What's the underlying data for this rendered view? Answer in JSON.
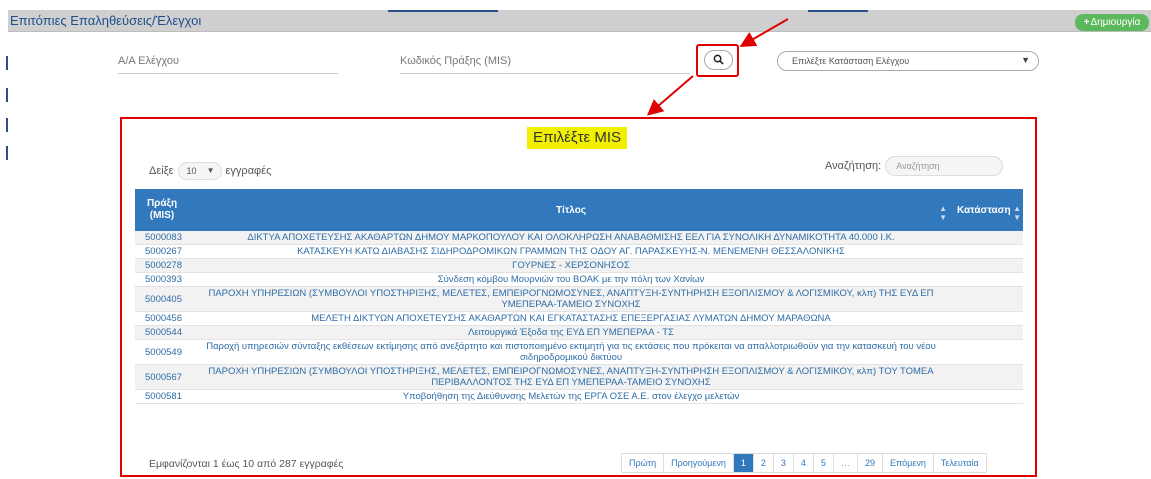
{
  "header": {
    "title": "Επιτόπιες Επαληθεύσεις/Έλεγχοι",
    "create_label": "Δημιουργία"
  },
  "filters": {
    "control_no_placeholder": "Α/Α Ελέγχου",
    "mis_code_placeholder": "Κωδικός Πράξης (MIS)",
    "status_placeholder": "Επιλέξτε Κατάσταση Ελέγχου"
  },
  "modal": {
    "title": "Επιλέξτε MIS",
    "show_label": "Δείξε",
    "page_length": "10",
    "records_label": "εγγραφές",
    "search_label": "Αναζήτηση:",
    "search_placeholder": "Αναζήτηση",
    "columns": {
      "mis_line1": "Πράξη",
      "mis_line2": "(MIS)",
      "title": "Τίτλος",
      "status": "Κατάσταση"
    },
    "rows": [
      {
        "mis": "5000083",
        "title": "ΔΙΚΤΥΑ ΑΠΟΧΕΤΕΥΣΗΣ ΑΚΑΘΑΡΤΩΝ ΔΗΜΟΥ ΜΑΡΚΟΠΟΥΛΟΥ ΚΑΙ ΟΛΟΚΛΗΡΩΣΗ ΑΝΑΒΑΘΜΙΣΗΣ ΕΕΛ ΓΙΑ ΣΥΝΟΛΙΚΗ ΔΥΝΑΜΙΚΟΤΗΤΑ 40.000 Ι.Κ.",
        "status": ""
      },
      {
        "mis": "5000267",
        "title": "ΚΑΤΑΣΚΕΥΗ ΚΑΤΩ ΔΙΑΒΑΣΗΣ ΣΙΔΗΡΟΔΡΟΜΙΚΩΝ ΓΡΑΜΜΩΝ ΤΗΣ ΟΔΟΥ ΑΓ. ΠΑΡΑΣΚΕΥΗΣ-Ν. ΜΕΝΕΜΕΝΗ ΘΕΣΣΑΛΟΝΙΚΗΣ",
        "status": ""
      },
      {
        "mis": "5000278",
        "title": "ΓΟΥΡΝΕΣ - ΧΕΡΣΟΝΗΣΟΣ",
        "status": ""
      },
      {
        "mis": "5000393",
        "title": "Σύνδεση κόμβου Μουρνιών του ΒΟΑΚ με την πόλη των Χανίων",
        "status": ""
      },
      {
        "mis": "5000405",
        "title": "ΠΑΡΟΧΗ ΥΠΗΡΕΣΙΩΝ (ΣΥΜΒΟΥΛΟΙ ΥΠΟΣΤΗΡΙΞΗΣ, ΜΕΛΕΤΕΣ, ΕΜΠΕΙΡΟΓΝΩΜΟΣΥΝΕΣ, ΑΝΑΠΤΥΞΗ-ΣΥΝΤΗΡΗΣΗ ΕΞΟΠΛΙΣΜΟΥ & ΛΟΓΙΣΜΙΚΟΥ, κλπ) ΤΗΣ ΕΥΔ ΕΠ ΥΜΕΠΕΡΑΑ-ΤΑΜΕΙΟ ΣΥΝΟΧΗΣ",
        "status": ""
      },
      {
        "mis": "5000456",
        "title": "ΜΕΛΕΤΗ ΔΙΚΤΥΩΝ ΑΠΟΧΕΤΕΥΣΗΣ ΑΚΑΘΑΡΤΩΝ ΚΑΙ ΕΓΚΑΤΑΣΤΑΣΗΣ ΕΠΕΞΕΡΓΑΣΙΑΣ ΛΥΜΑΤΩΝ ΔΗΜΟΥ ΜΑΡΑΘΩΝΑ",
        "status": ""
      },
      {
        "mis": "5000544",
        "title": "Λειτουργικά Έξοδα της ΕΥΔ ΕΠ ΥΜΕΠΕΡΑΑ - ΤΣ",
        "status": ""
      },
      {
        "mis": "5000549",
        "title": "Παροχή υπηρεσιών σύνταξης εκθέσεων εκτίμησης από ανεξάρτητο και πιστοποιημένο εκτιμητή για τις εκτάσεις που πρόκειται να απαλλοτριωθούν για την κατασκευή του νέου σιδηροδρομικού δικτύου",
        "status": ""
      },
      {
        "mis": "5000567",
        "title": "ΠΑΡΟΧΗ ΥΠΗΡΕΣΙΩΝ (ΣΥΜΒΟΥΛΟΙ ΥΠΟΣΤΗΡΙΞΗΣ, ΜΕΛΕΤΕΣ, ΕΜΠΕΙΡΟΓΝΩΜΟΣΥΝΕΣ, ΑΝΑΠΤΥΞΗ-ΣΥΝΤΗΡΗΣΗ ΕΞΟΠΛΙΣΜΟΥ & ΛΟΓΙΣΜΙΚΟΥ, κλπ) ΤΟΥ ΤΟΜΕΑ ΠΕΡΙΒΑΛΛΟΝΤΟΣ ΤΗΣ ΕΥΔ ΕΠ ΥΜΕΠΕΡΑΑ-ΤΑΜΕΙΟ ΣΥΝΟΧΗΣ",
        "status": ""
      },
      {
        "mis": "5000581",
        "title": "Υποβοήθηση της Διεύθυνσης Μελετών της ΕΡΓΑ ΟΣΕ Α.Ε. στον έλεγχο μελετών",
        "status": ""
      }
    ],
    "info": "Εμφανίζονται 1 έως 10 από 287 εγγραφές",
    "pagination": {
      "first": "Πρώτη",
      "previous": "Προηγούμενη",
      "pages": [
        "1",
        "2",
        "3",
        "4",
        "5"
      ],
      "ellipsis": "…",
      "last_page": "29",
      "next": "Επόμενη",
      "last": "Τελευταία"
    }
  },
  "colors": {
    "accent_blue": "#3178bd",
    "create_green": "#5cb85c",
    "highlight_red": "#e00000",
    "title_highlight": "#f0f000"
  }
}
